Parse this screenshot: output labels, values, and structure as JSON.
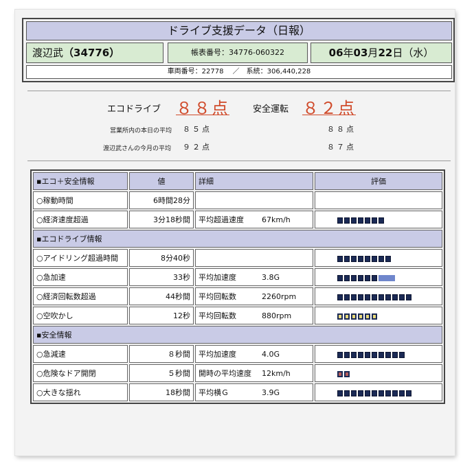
{
  "report": {
    "title": "ドライブ支援データ（日報）",
    "driver_name": "渡辺武",
    "driver_id": "（34776）",
    "doc_number_label": "帳表番号：34776-060322",
    "date_year": "06",
    "date_y_suffix": "年",
    "date_month": "03",
    "date_m_suffix": "月",
    "date_day": "22",
    "date_d_suffix": "日",
    "date_weekday": "（水）",
    "vehicle_info": "車両番号：22778　 ／　系統：306,440,228"
  },
  "scores": {
    "eco_label": "エコドライブ",
    "eco_value": "８８点",
    "safety_label": "安全運転",
    "safety_value": "８２点",
    "office_avg_label": "営業所内の本日の平均",
    "office_avg_eco": "８５点",
    "office_avg_safety": "８８点",
    "monthly_avg_label": "渡辺武さんの今月の平均",
    "monthly_avg_eco": "９２点",
    "monthly_avg_safety": "８７点"
  },
  "table": {
    "headers": {
      "item": "▪エコ＋安全情報",
      "value": "値",
      "detail": "詳細",
      "rating": "評価"
    },
    "section_eco": "▪エコドライブ情報",
    "section_safety": "▪安全情報",
    "rows": [
      {
        "item": "○稼動時間",
        "value": "6時間28分",
        "detail_label": "",
        "detail_value": "",
        "rating_segments": 0
      },
      {
        "item": "○経済速度超過",
        "value": "3分18秒間",
        "detail_label": "平均超過速度",
        "detail_value": "67km/h",
        "rating_segments": 7
      },
      {
        "item": "○アイドリング超過時間",
        "value": "8分40秒",
        "detail_label": "",
        "detail_value": "",
        "rating_segments": 8
      },
      {
        "item": "○急加速",
        "value": "33秒",
        "detail_label": "平均加速度",
        "detail_value": "3.8G",
        "rating_segments": 6
      },
      {
        "item": "○経済回転数超過",
        "value": "44秒間",
        "detail_label": "平均回転数",
        "detail_value": "2260rpm",
        "rating_segments": 11
      },
      {
        "item": "○空吹かし",
        "value": "12秒",
        "detail_label": "平均回転数",
        "detail_value": "880rpm",
        "rating_segments": 6
      },
      {
        "item": "○急減速",
        "value": "８秒間",
        "detail_label": "平均加速度",
        "detail_value": "4.0G",
        "rating_segments": 10
      },
      {
        "item": "○危険なドア開閉",
        "value": "５秒間",
        "detail_label": "開時の平均速度",
        "detail_value": "12km/h",
        "rating_segments": 2
      },
      {
        "item": "○大きな揺れ",
        "value": "18秒間",
        "detail_label": "平均横Ｇ",
        "detail_value": "3.9G",
        "rating_segments": 11
      }
    ]
  },
  "colors": {
    "header_bg": "#c9cbe6",
    "name_row_bg": "#d8ebd2",
    "score_red": "#d04a2a",
    "bar_dark": "#1b2a55",
    "bar_yellow": "#e8d97a",
    "bar_red": "#b75d5d",
    "bar_light_blue": "#6f86cc"
  }
}
